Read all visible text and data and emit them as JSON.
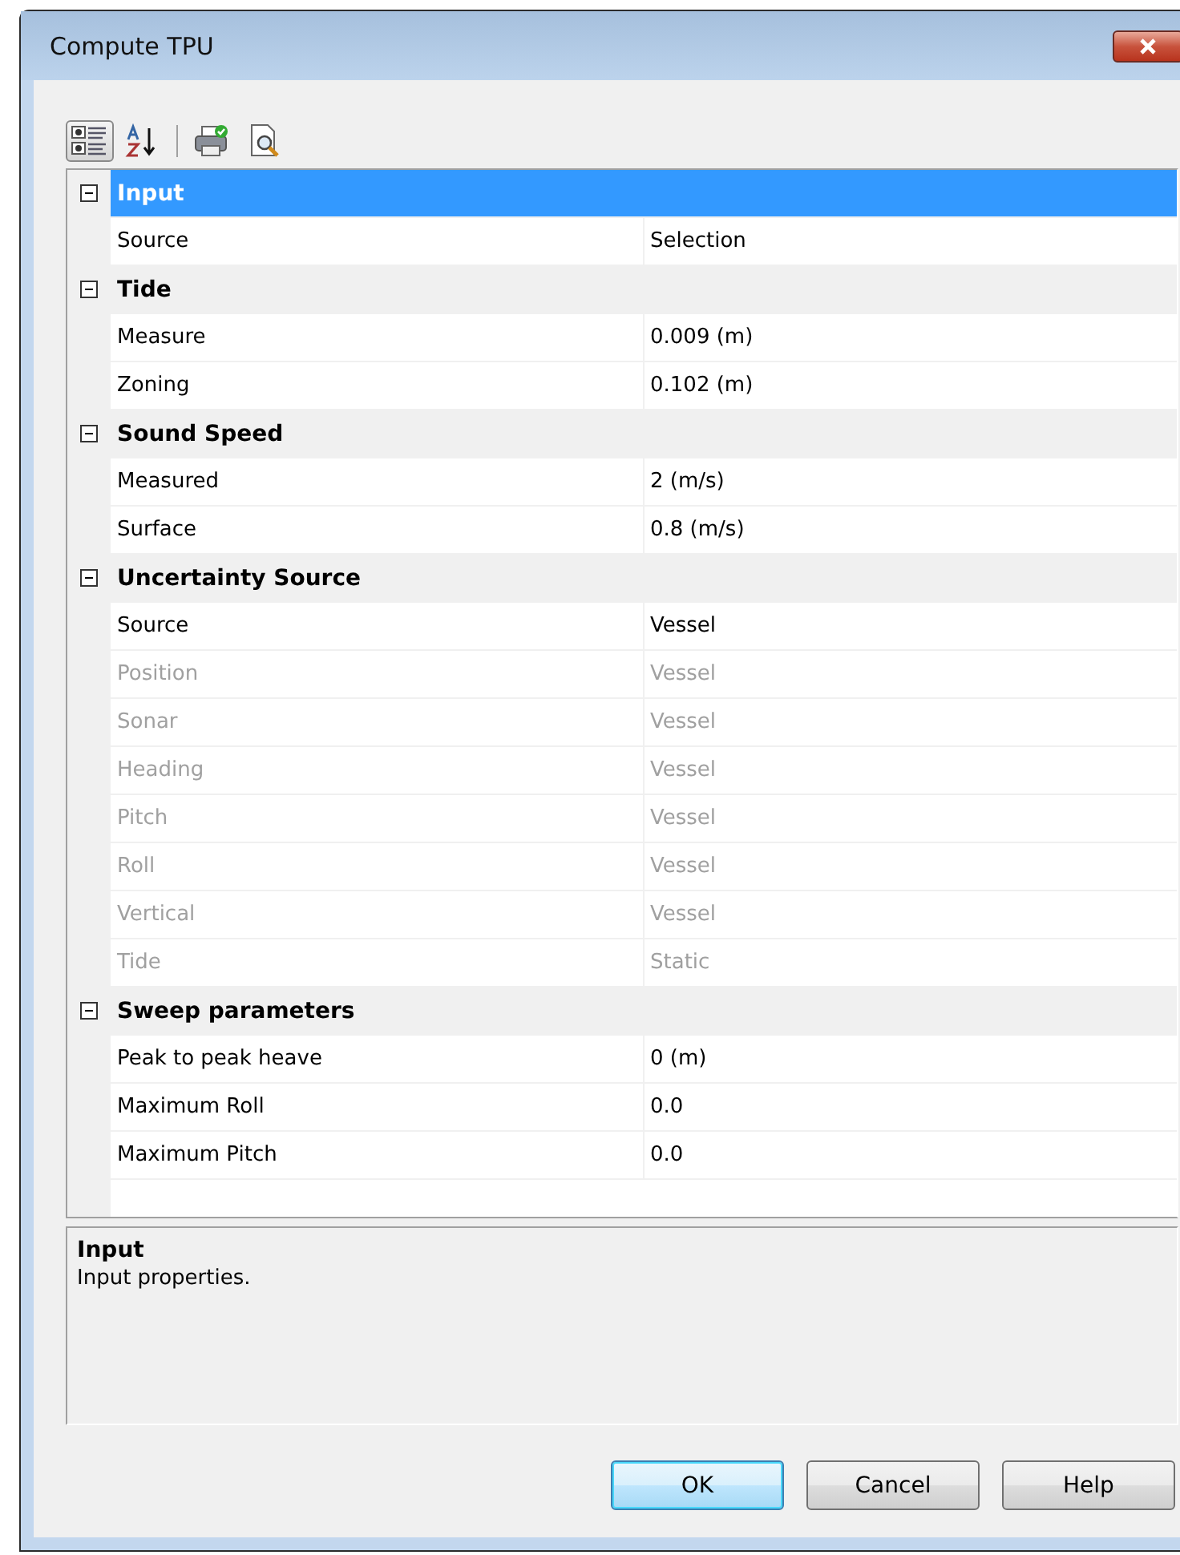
{
  "window": {
    "title": "Compute TPU"
  },
  "toolbar": [
    {
      "kind": "categorized",
      "selected": true
    },
    {
      "kind": "alphabetical",
      "selected": false
    },
    {
      "kind": "separator"
    },
    {
      "kind": "print"
    },
    {
      "kind": "preview"
    }
  ],
  "categories": [
    {
      "name": "Input",
      "expanded": true,
      "selected": true,
      "properties": [
        {
          "name": "Source",
          "value": "Selection",
          "disabled": false
        }
      ]
    },
    {
      "name": "Tide",
      "expanded": true,
      "selected": false,
      "properties": [
        {
          "name": "Measure",
          "value": "0.009 (m)",
          "disabled": false
        },
        {
          "name": "Zoning",
          "value": "0.102 (m)",
          "disabled": false
        }
      ]
    },
    {
      "name": "Sound Speed",
      "expanded": true,
      "selected": false,
      "properties": [
        {
          "name": "Measured",
          "value": "2 (m/s)",
          "disabled": false
        },
        {
          "name": "Surface",
          "value": "0.8 (m/s)",
          "disabled": false
        }
      ]
    },
    {
      "name": "Uncertainty Source",
      "expanded": true,
      "selected": false,
      "properties": [
        {
          "name": "Source",
          "value": "Vessel",
          "disabled": false
        },
        {
          "name": "Position",
          "value": "Vessel",
          "disabled": true
        },
        {
          "name": "Sonar",
          "value": "Vessel",
          "disabled": true
        },
        {
          "name": "Heading",
          "value": "Vessel",
          "disabled": true
        },
        {
          "name": "Pitch",
          "value": "Vessel",
          "disabled": true
        },
        {
          "name": "Roll",
          "value": "Vessel",
          "disabled": true
        },
        {
          "name": "Vertical",
          "value": "Vessel",
          "disabled": true
        },
        {
          "name": "Tide",
          "value": "Static",
          "disabled": true
        }
      ]
    },
    {
      "name": "Sweep parameters",
      "expanded": true,
      "selected": false,
      "properties": [
        {
          "name": "Peak to peak heave",
          "value": "0 (m)",
          "disabled": false
        },
        {
          "name": "Maximum Roll",
          "value": "0.0",
          "disabled": false
        },
        {
          "name": "Maximum Pitch",
          "value": "0.0",
          "disabled": false
        }
      ]
    }
  ],
  "description": {
    "title": "Input",
    "text": "Input properties."
  },
  "buttons": [
    {
      "label": "OK",
      "default": true
    },
    {
      "label": "Cancel",
      "default": false
    },
    {
      "label": "Help",
      "default": false
    }
  ]
}
